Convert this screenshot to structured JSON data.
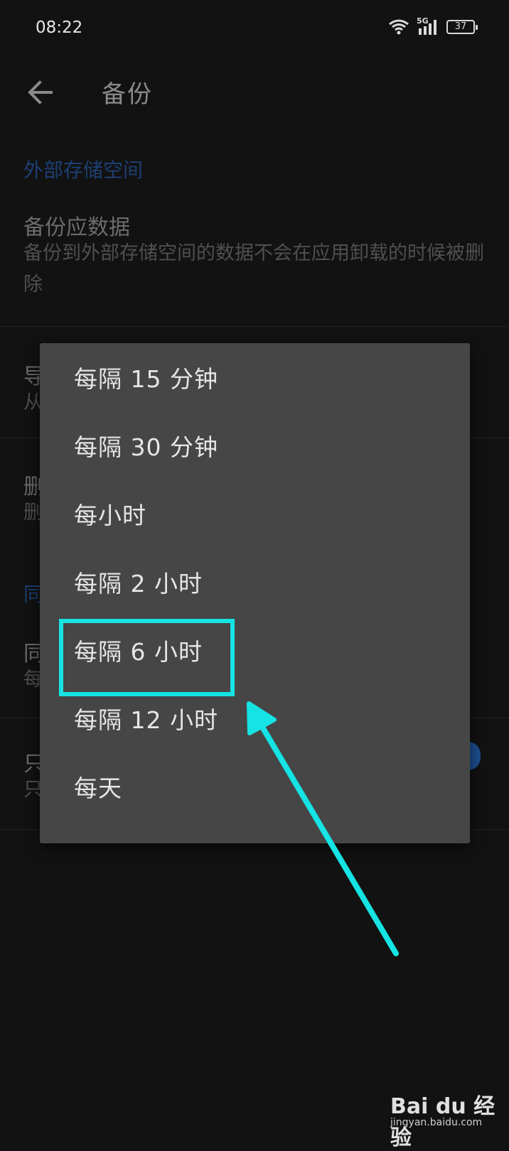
{
  "status_bar": {
    "time": "08:22",
    "network": "5G",
    "battery": "37"
  },
  "app_bar": {
    "title": "备份"
  },
  "sections": {
    "external_storage_header": "外部存储空间",
    "backup_app_data": {
      "title": "备份应数据",
      "summary": "备份到外部存储空间的数据不会在应用卸载的时候被删除"
    },
    "hidden_rows": [
      {
        "title": "导",
        "summary": "从"
      },
      {
        "title": "删",
        "summary": "删"
      },
      {
        "header": "同"
      },
      {
        "title": "同",
        "summary": "每"
      },
      {
        "title": "只",
        "summary": "只"
      }
    ]
  },
  "interval_menu": {
    "options": [
      "每隔 15 分钟",
      "每隔 30 分钟",
      "每小时",
      "每隔 2 小时",
      "每隔 6 小时",
      "每隔 12 小时",
      "每天"
    ],
    "highlighted": "每隔 6 小时"
  },
  "annotation": {
    "color": "#16e3e3"
  },
  "watermark": {
    "logo": "Bai du 经验",
    "url": "jingyan.baidu.com"
  }
}
